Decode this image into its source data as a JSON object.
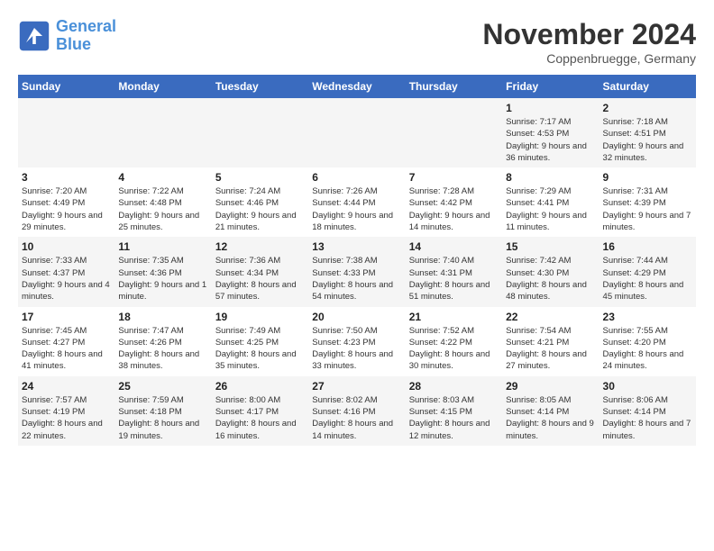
{
  "header": {
    "logo_line1": "General",
    "logo_line2": "Blue",
    "month": "November 2024",
    "location": "Coppenbruegge, Germany"
  },
  "weekdays": [
    "Sunday",
    "Monday",
    "Tuesday",
    "Wednesday",
    "Thursday",
    "Friday",
    "Saturday"
  ],
  "weeks": [
    [
      {
        "day": "",
        "info": ""
      },
      {
        "day": "",
        "info": ""
      },
      {
        "day": "",
        "info": ""
      },
      {
        "day": "",
        "info": ""
      },
      {
        "day": "",
        "info": ""
      },
      {
        "day": "1",
        "info": "Sunrise: 7:17 AM\nSunset: 4:53 PM\nDaylight: 9 hours and 36 minutes."
      },
      {
        "day": "2",
        "info": "Sunrise: 7:18 AM\nSunset: 4:51 PM\nDaylight: 9 hours and 32 minutes."
      }
    ],
    [
      {
        "day": "3",
        "info": "Sunrise: 7:20 AM\nSunset: 4:49 PM\nDaylight: 9 hours and 29 minutes."
      },
      {
        "day": "4",
        "info": "Sunrise: 7:22 AM\nSunset: 4:48 PM\nDaylight: 9 hours and 25 minutes."
      },
      {
        "day": "5",
        "info": "Sunrise: 7:24 AM\nSunset: 4:46 PM\nDaylight: 9 hours and 21 minutes."
      },
      {
        "day": "6",
        "info": "Sunrise: 7:26 AM\nSunset: 4:44 PM\nDaylight: 9 hours and 18 minutes."
      },
      {
        "day": "7",
        "info": "Sunrise: 7:28 AM\nSunset: 4:42 PM\nDaylight: 9 hours and 14 minutes."
      },
      {
        "day": "8",
        "info": "Sunrise: 7:29 AM\nSunset: 4:41 PM\nDaylight: 9 hours and 11 minutes."
      },
      {
        "day": "9",
        "info": "Sunrise: 7:31 AM\nSunset: 4:39 PM\nDaylight: 9 hours and 7 minutes."
      }
    ],
    [
      {
        "day": "10",
        "info": "Sunrise: 7:33 AM\nSunset: 4:37 PM\nDaylight: 9 hours and 4 minutes."
      },
      {
        "day": "11",
        "info": "Sunrise: 7:35 AM\nSunset: 4:36 PM\nDaylight: 9 hours and 1 minute."
      },
      {
        "day": "12",
        "info": "Sunrise: 7:36 AM\nSunset: 4:34 PM\nDaylight: 8 hours and 57 minutes."
      },
      {
        "day": "13",
        "info": "Sunrise: 7:38 AM\nSunset: 4:33 PM\nDaylight: 8 hours and 54 minutes."
      },
      {
        "day": "14",
        "info": "Sunrise: 7:40 AM\nSunset: 4:31 PM\nDaylight: 8 hours and 51 minutes."
      },
      {
        "day": "15",
        "info": "Sunrise: 7:42 AM\nSunset: 4:30 PM\nDaylight: 8 hours and 48 minutes."
      },
      {
        "day": "16",
        "info": "Sunrise: 7:44 AM\nSunset: 4:29 PM\nDaylight: 8 hours and 45 minutes."
      }
    ],
    [
      {
        "day": "17",
        "info": "Sunrise: 7:45 AM\nSunset: 4:27 PM\nDaylight: 8 hours and 41 minutes."
      },
      {
        "day": "18",
        "info": "Sunrise: 7:47 AM\nSunset: 4:26 PM\nDaylight: 8 hours and 38 minutes."
      },
      {
        "day": "19",
        "info": "Sunrise: 7:49 AM\nSunset: 4:25 PM\nDaylight: 8 hours and 35 minutes."
      },
      {
        "day": "20",
        "info": "Sunrise: 7:50 AM\nSunset: 4:23 PM\nDaylight: 8 hours and 33 minutes."
      },
      {
        "day": "21",
        "info": "Sunrise: 7:52 AM\nSunset: 4:22 PM\nDaylight: 8 hours and 30 minutes."
      },
      {
        "day": "22",
        "info": "Sunrise: 7:54 AM\nSunset: 4:21 PM\nDaylight: 8 hours and 27 minutes."
      },
      {
        "day": "23",
        "info": "Sunrise: 7:55 AM\nSunset: 4:20 PM\nDaylight: 8 hours and 24 minutes."
      }
    ],
    [
      {
        "day": "24",
        "info": "Sunrise: 7:57 AM\nSunset: 4:19 PM\nDaylight: 8 hours and 22 minutes."
      },
      {
        "day": "25",
        "info": "Sunrise: 7:59 AM\nSunset: 4:18 PM\nDaylight: 8 hours and 19 minutes."
      },
      {
        "day": "26",
        "info": "Sunrise: 8:00 AM\nSunset: 4:17 PM\nDaylight: 8 hours and 16 minutes."
      },
      {
        "day": "27",
        "info": "Sunrise: 8:02 AM\nSunset: 4:16 PM\nDaylight: 8 hours and 14 minutes."
      },
      {
        "day": "28",
        "info": "Sunrise: 8:03 AM\nSunset: 4:15 PM\nDaylight: 8 hours and 12 minutes."
      },
      {
        "day": "29",
        "info": "Sunrise: 8:05 AM\nSunset: 4:14 PM\nDaylight: 8 hours and 9 minutes."
      },
      {
        "day": "30",
        "info": "Sunrise: 8:06 AM\nSunset: 4:14 PM\nDaylight: 8 hours and 7 minutes."
      }
    ]
  ]
}
